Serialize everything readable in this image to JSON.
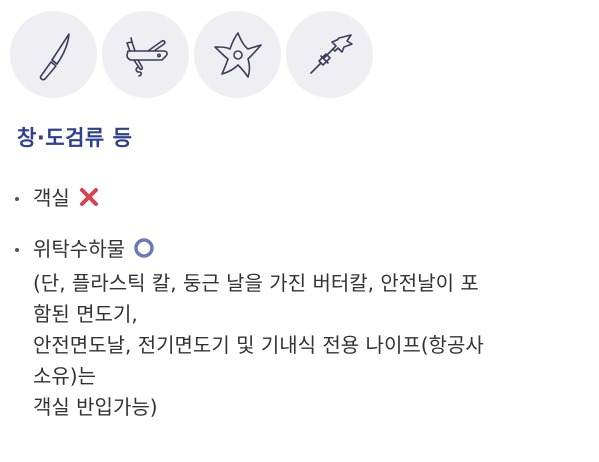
{
  "icons": [
    {
      "name": "knife-icon"
    },
    {
      "name": "multitool-knife-icon"
    },
    {
      "name": "shuriken-icon"
    },
    {
      "name": "dart-icon"
    }
  ],
  "section": {
    "title": "창·도검류 등"
  },
  "rules": [
    {
      "label": "객실",
      "status_icon": "cross-mark-icon",
      "status_color": "#d94150"
    },
    {
      "label": "위탁수하물",
      "status_icon": "circle-ok-icon",
      "status_color": "#6d79b8",
      "note_lines": [
        "(단, 플라스틱 칼, 둥근 날을 가진 버터칼, 안전날이 포",
        "함된 면도기,",
        "안전면도날, 전기면도기 및 기내식 전용 나이프(항공사",
        "소유)는",
        "객실 반입가능)"
      ]
    }
  ],
  "colors": {
    "title": "#2f3f8f",
    "icon_bg": "#efeff3",
    "icon_stroke": "#3d3f5a"
  }
}
